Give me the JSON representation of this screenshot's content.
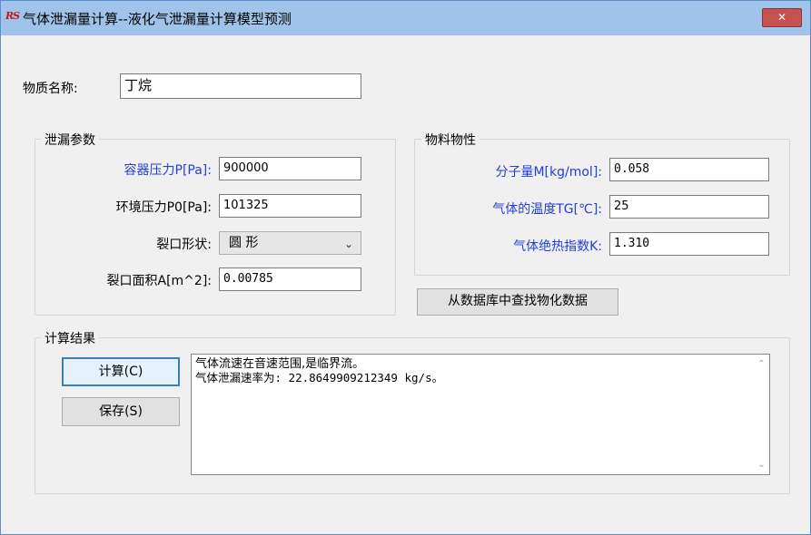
{
  "window": {
    "title": "气体泄漏量计算--液化气泄漏量计算模型预测",
    "icon_text": "RS",
    "close_glyph": "✕"
  },
  "substance": {
    "label": "物质名称:",
    "value": "丁烷"
  },
  "leak_params": {
    "title": "泄漏参数",
    "vessel_pressure": {
      "label": "容器压力P[Pa]:",
      "value": "900000"
    },
    "ambient_pressure": {
      "label": "环境压力P0[Pa]:",
      "value": "101325"
    },
    "hole_shape": {
      "label": "裂口形状:",
      "value": "圆 形"
    },
    "hole_area": {
      "label": "裂口面积A[m^2]:",
      "value": "0.00785"
    }
  },
  "material_props": {
    "title": "物料物性",
    "molecular_weight": {
      "label": "分子量M[kg/mol]:",
      "value": "0.058"
    },
    "gas_temperature": {
      "label": "气体的温度TG[℃]:",
      "value": "25"
    },
    "adiabatic_index": {
      "label": "气体绝热指数K:",
      "value": "1.310"
    },
    "lookup_button": "从数据库中查找物化数据"
  },
  "results": {
    "title": "计算结果",
    "calc_button": "计算(C)",
    "save_button": "保存(S)",
    "line1": "气体流速在音速范围,是临界流。",
    "line2": "气体泄漏速率为: 22.8649909212349 kg/s。"
  },
  "colors": {
    "titlebar": "#9fc3ea",
    "label_blue": "#1f3fd6",
    "close_red": "#c75050"
  }
}
